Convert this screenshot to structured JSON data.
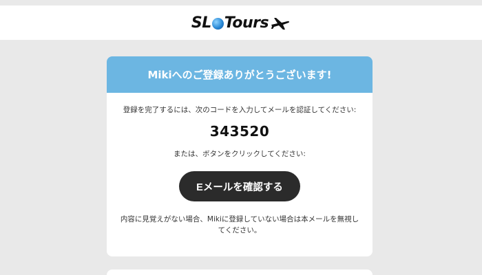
{
  "brand": {
    "logo_text_before": "SL",
    "logo_text_after": "Tours",
    "icon": "airplane-icon"
  },
  "card": {
    "header_title": "Mikiへのご登録ありがとうございます!",
    "instruction": "登録を完了するには、次のコードを入力してメールを認証してください:",
    "code": "343520",
    "or_text": "または、ボタンをクリックしてください:",
    "button_label": "Eメールを確認する",
    "footer_note": "内容に見覚えがない場合、Mikiに登録していない場合は本メールを無視してください。"
  },
  "colors": {
    "header": "#6cb6e2",
    "button": "#2b2b2b",
    "background": "#e9e9e9"
  }
}
